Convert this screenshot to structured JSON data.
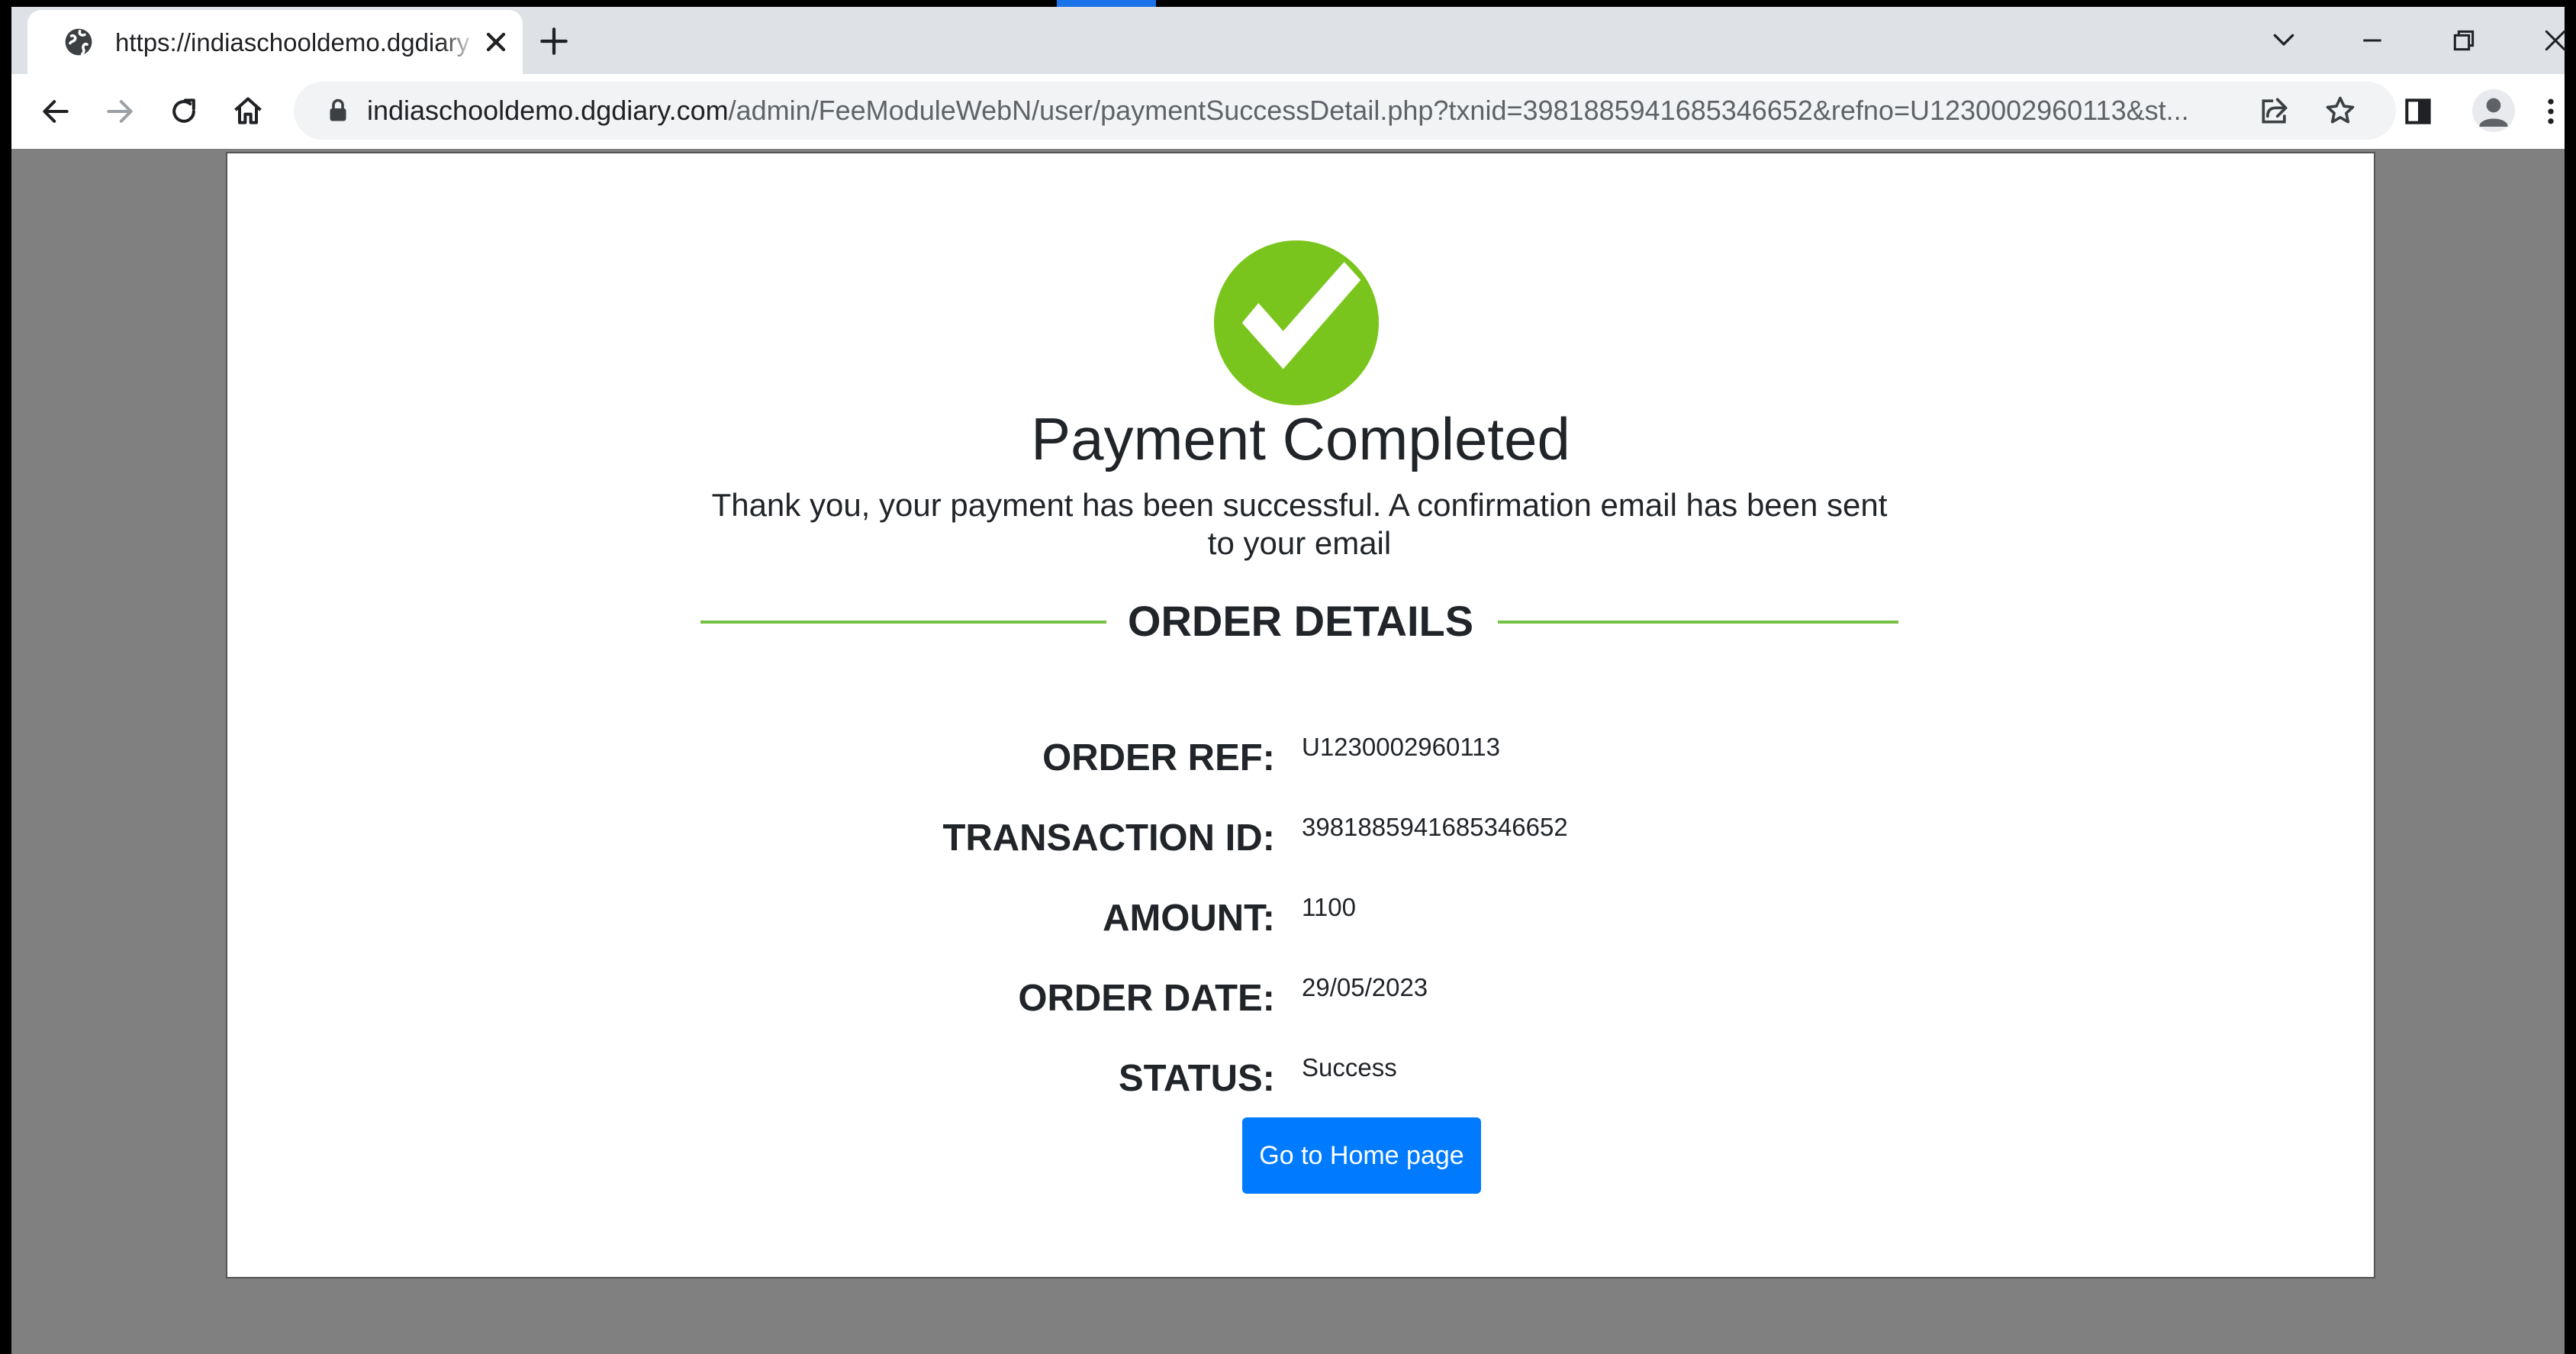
{
  "browser": {
    "tab": {
      "title": "https://indiaschooldemo.dgdiary",
      "favicon": "globe-icon",
      "close_icon": "close-icon"
    },
    "new_tab_icon": "plus-icon",
    "window_controls": [
      "chevron-down-icon",
      "minimize-icon",
      "restore-icon",
      "close-icon"
    ],
    "url_host": "indiaschooldemo.dgdiary.com",
    "url_path": "/admin/FeeModuleWebN/user/paymentSuccessDetail.php?txnid=3981885941685346652&refno=U1230002960113&st...",
    "toolbar_icons": [
      "back-arrow-icon",
      "forward-arrow-icon",
      "reload-icon",
      "home-icon",
      "lock-icon",
      "share-icon",
      "star-icon",
      "side-panel-icon",
      "profile-avatar",
      "more-menu-icon"
    ]
  },
  "page": {
    "status_icon": "check-circle-icon",
    "title": "Payment Completed",
    "message": "Thank you, your payment has been successful. A confirmation email has been sent to your email",
    "section_title": "ORDER DETAILS",
    "details": [
      {
        "label": "ORDER REF:",
        "value": "U1230002960113"
      },
      {
        "label": "TRANSACTION ID:",
        "value": "3981885941685346652"
      },
      {
        "label": "AMOUNT:",
        "value": "1100"
      },
      {
        "label": "ORDER DATE:",
        "value": "29/05/2023"
      },
      {
        "label": "STATUS:",
        "value": "Success"
      }
    ],
    "home_button": "Go to Home page"
  },
  "colors": {
    "accent_green": "#7ac51d",
    "divider_green": "#76c043",
    "button_blue": "#007bff",
    "viewport_gray": "#808080"
  }
}
